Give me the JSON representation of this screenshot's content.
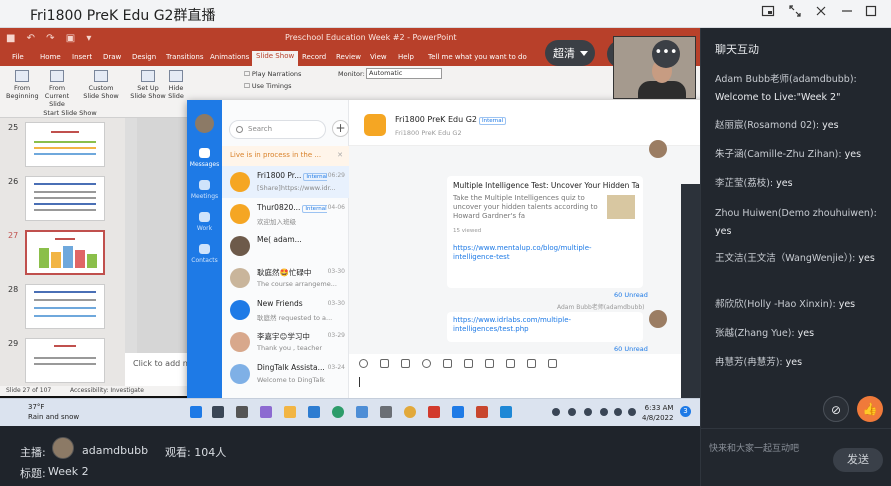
{
  "window": {
    "title": "Fri1800 PreK  Edu  G2群直播",
    "icons": [
      "picture-in-picture-icon",
      "fullscreen-icon",
      "close-icon",
      "minimize-icon",
      "maximize-icon"
    ]
  },
  "ppt": {
    "doc_title": "Preschool Education Week #2 - PowerPoint",
    "menu": [
      "File",
      "Home",
      "Insert",
      "Draw",
      "Design",
      "Transitions",
      "Animations",
      "Slide Show",
      "Record",
      "Review",
      "View",
      "Help"
    ],
    "active_menu": "Slide Show",
    "tell_me": "Tell me what you want to do",
    "ribbon": {
      "from_beginning": "From Beginning",
      "from_current": "From Current Slide",
      "custom": "Custom Slide Show",
      "setup": "Set Up Slide Show",
      "hide": "Hide Slide",
      "group_label": "Start Slide Show",
      "play_narrations": "Play Narrations",
      "use_timings": "Use Timings",
      "monitor_label": "Monitor:",
      "monitor_value": "Automatic"
    },
    "slides": [
      "25",
      "26",
      "27",
      "28",
      "29"
    ],
    "selected_slide": "27",
    "notes_placeholder": "Click to add no",
    "status_slide": "Slide 27 of 107",
    "status_accessibility": "Accessibility: Investigate"
  },
  "taskbar": {
    "temp": "37°F",
    "weather": "Rain and snow",
    "time": "6:33 AM",
    "date": "4/8/2022",
    "notif": "3"
  },
  "dingtalk": {
    "nav": [
      {
        "label": "Messages",
        "active": true
      },
      {
        "label": "Meetings",
        "active": false
      },
      {
        "label": "Work",
        "active": false
      },
      {
        "label": "Contacts",
        "active": false
      }
    ],
    "search_placeholder": "Search",
    "live_banner": "Live is in process in the ...",
    "conversations": [
      {
        "name": "Fri1800 Pr...",
        "tag": "Internal",
        "msg": "[Share]https://www.idr...",
        "time": "06:29",
        "color": "#f5a623",
        "selected": true
      },
      {
        "name": "Thur0820...",
        "tag": "Internal",
        "msg": "欢迎加入班级",
        "time": "04-06",
        "color": "#f5a623",
        "selected": false
      },
      {
        "name": "Me( adam...",
        "tag": "",
        "msg": "",
        "time": "",
        "color": "#6d5a4a",
        "selected": false
      },
      {
        "name": "耿庭然🤩忙碌中",
        "tag": "",
        "msg": "The course arrangeme...",
        "time": "03-30",
        "color": "#c9b59b",
        "selected": false
      },
      {
        "name": "New Friends",
        "tag": "",
        "msg": "耿庭然 requested to a...",
        "time": "03-30",
        "color": "#1e7ae6",
        "selected": false
      },
      {
        "name": "李嘉宇😊学习中",
        "tag": "",
        "msg": "Thank you , teacher",
        "time": "03-29",
        "color": "#d8a88c",
        "selected": false
      },
      {
        "name": "DingTalk Assista...",
        "tag": "",
        "msg": "Welcome to DingTalk",
        "time": "03-24",
        "color": "#7fb0e6",
        "selected": false
      }
    ],
    "chat": {
      "group_name": "Fri1800 PreK  Edu  G2",
      "group_tag": "Internal",
      "group_sub": "Fri1800 PreK  Edu  G2",
      "card": {
        "title": "Multiple Intelligence Test: Uncover Your Hidden Ta",
        "desc": "Take the Multiple Intelligences quiz to uncover your hidden talents according to Howard Gardner's fa",
        "views": "15 viewed",
        "link": "https://www.mentalup.co/blog/multiple-intelligence-test",
        "unread": "60 Unread"
      },
      "sender": "Adam Bubb老师(adamdbubb)",
      "bubble_link": "https://www.idrlabs.com/multiple-intelligences/test.php",
      "unread2": "60 Unread"
    }
  },
  "overlay": {
    "quality": "超清",
    "more": "•••"
  },
  "info": {
    "host_label": "主播:",
    "host_name": "adamdbubb",
    "viewers": "观看: 104人",
    "title_label": "标题:",
    "title_value": "Week 2"
  },
  "panel": {
    "header": "聊天互动",
    "messages": [
      {
        "who": "Adam Bubb老师(adamdbubb):",
        "text": "Welcome to Live:\"Week 2\""
      },
      {
        "who": "赵丽宸(Rosamond 02):",
        "text": "yes"
      },
      {
        "who": "朱子涵(Camille-Zhu Zihan):",
        "text": "yes"
      },
      {
        "who": "李芷莹(荔枝):",
        "text": "yes"
      },
      {
        "who": "Zhou Huiwen(Demo zhouhuiwen):",
        "text": "yes"
      },
      {
        "who": "王文洁(王文洁（WangWenjie）):",
        "text": "yes"
      },
      {
        "who": "郝欣欣(Holly -Hao Xinxin):",
        "text": "yes"
      },
      {
        "who": "张越(Zhang Yue):",
        "text": "yes"
      },
      {
        "who": "冉慧芳(冉慧芳):",
        "text": "yes"
      }
    ],
    "input_placeholder": "快来和大家一起互动吧",
    "send_label": "发送"
  }
}
